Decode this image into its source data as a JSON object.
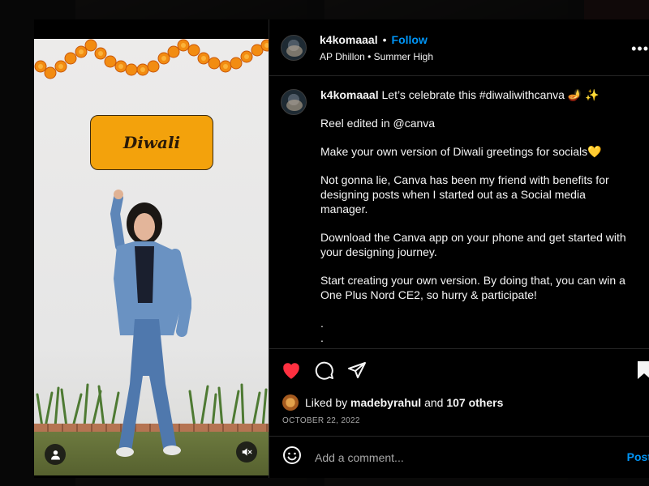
{
  "post": {
    "username": "k4komaaal",
    "follow_label": "Follow",
    "separator": "•",
    "audio": "AP Dhillon • Summer High",
    "more_label": "•••",
    "caption_paragraphs": [
      "Let’s celebrate this #diwaliwithcanva 🪔 ✨",
      "Reel edited in @canva",
      "Make your own version of Diwali greetings for socials💛",
      "Not gonna lie, Canva has been my friend with benefits for designing posts when I started out as a Social media manager.",
      "Download the Canva app on your phone and get started with your designing journey.",
      "Start creating your own version. By doing that, you can win a One Plus Nord CE2, so hurry & participate!",
      ".\n."
    ],
    "sign_text": "Diwali",
    "likes": {
      "prefix": "Liked by",
      "user": "madebyrahul",
      "middle": "and",
      "others": "107 others"
    },
    "date": "OCTOBER 22, 2022",
    "comment": {
      "placeholder": "Add a comment...",
      "post_label": "Post"
    }
  },
  "icons": {
    "like": "heart-filled-icon",
    "comment": "comment-bubble-icon",
    "share": "paper-plane-icon",
    "save": "bookmark-icon",
    "emoji": "smiley-icon",
    "mute": "speaker-muted-icon",
    "tag": "person-icon"
  },
  "colors": {
    "link": "#0095f6",
    "like": "#ff3040",
    "sign": "#f3a20c",
    "marigold": "#f28c12"
  }
}
